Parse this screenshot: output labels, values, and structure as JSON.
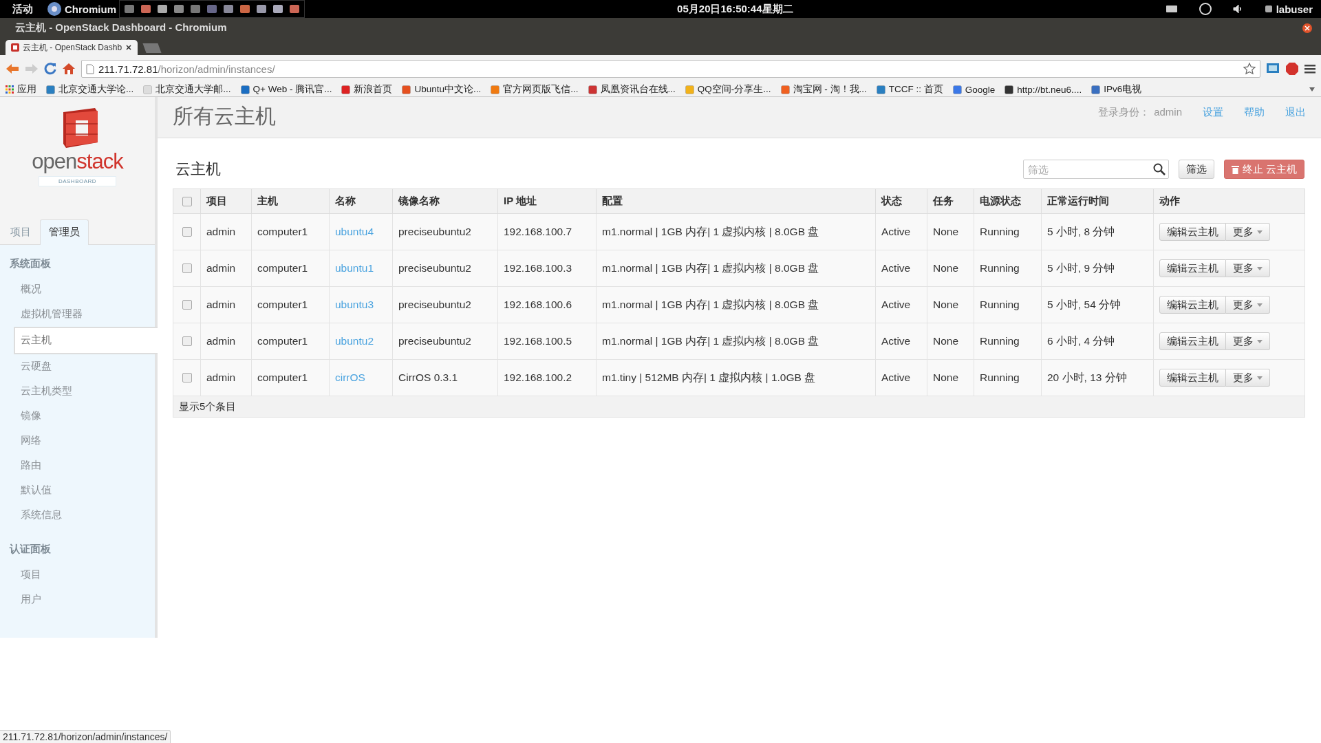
{
  "system_bar": {
    "activities": "活动",
    "app_name": "Chromium",
    "clock": "05月20日16:50:44星期二",
    "user": "labuser"
  },
  "window": {
    "title": "云主机 - OpenStack Dashboard - Chromium"
  },
  "tabs": [
    {
      "label": "云主机 - OpenStack Dashb",
      "selected": true
    }
  ],
  "address_bar": {
    "host": "211.71.72.81",
    "path": "/horizon/admin/instances/"
  },
  "bookmarks": [
    {
      "label": "应用"
    },
    {
      "label": "北京交通大学论..."
    },
    {
      "label": "北京交通大学邮..."
    },
    {
      "label": "Q+ Web - 腾讯官..."
    },
    {
      "label": "新浪首页"
    },
    {
      "label": "Ubuntu中文论..."
    },
    {
      "label": "官方网页版飞信..."
    },
    {
      "label": "凤凰资讯台在线..."
    },
    {
      "label": "QQ空间-分享生..."
    },
    {
      "label": "淘宝网 - 淘！我..."
    },
    {
      "label": "TCCF :: 首页"
    },
    {
      "label": "Google"
    },
    {
      "label": "http://bt.neu6...."
    },
    {
      "label": "IPv6电视"
    }
  ],
  "sidebar": {
    "logo": {
      "word_1": "open",
      "word_2": "stack",
      "badge": "DASHBOARD"
    },
    "tabs": [
      {
        "label": "项目",
        "selected": false
      },
      {
        "label": "管理员",
        "selected": true
      }
    ],
    "sections": [
      {
        "title": "系统面板",
        "items": [
          {
            "label": "概况",
            "selected": false
          },
          {
            "label": "虚拟机管理器",
            "selected": false
          },
          {
            "label": "云主机",
            "selected": true
          },
          {
            "label": "云硬盘",
            "selected": false
          },
          {
            "label": "云主机类型",
            "selected": false
          },
          {
            "label": "镜像",
            "selected": false
          },
          {
            "label": "网络",
            "selected": false
          },
          {
            "label": "路由",
            "selected": false
          },
          {
            "label": "默认值",
            "selected": false
          },
          {
            "label": "系统信息",
            "selected": false
          }
        ]
      },
      {
        "title": "认证面板",
        "items": [
          {
            "label": "项目",
            "selected": false
          },
          {
            "label": "用户",
            "selected": false
          }
        ]
      }
    ]
  },
  "header": {
    "title": "所有云主机",
    "user_label": "登录身份：",
    "user": "admin",
    "links": [
      "设置",
      "帮助",
      "退出"
    ]
  },
  "content": {
    "title": "云主机",
    "filter_placeholder": "筛选",
    "filter_button": "筛选",
    "terminate_button": "终止 云主机"
  },
  "table": {
    "select_all": {
      "checked": false
    },
    "columns": [
      "项目",
      "主机",
      "名称",
      "镜像名称",
      "IP 地址",
      "配置",
      "状态",
      "任务",
      "电源状态",
      "正常运行时间",
      "动作"
    ],
    "rows": [
      {
        "checked": false,
        "cells": [
          "admin",
          "computer1",
          "ubuntu4",
          "preciseubuntu2",
          "192.168.100.7",
          "m1.normal | 1GB 内存| 1 虚拟内核 | 8.0GB 盘",
          "Active",
          "None",
          "Running",
          "5 小时, 8 分钟"
        ],
        "actions": [
          "编辑云主机",
          "更多"
        ]
      },
      {
        "checked": false,
        "cells": [
          "admin",
          "computer1",
          "ubuntu1",
          "preciseubuntu2",
          "192.168.100.3",
          "m1.normal | 1GB 内存| 1 虚拟内核 | 8.0GB 盘",
          "Active",
          "None",
          "Running",
          "5 小时, 9 分钟"
        ],
        "actions": [
          "编辑云主机",
          "更多"
        ]
      },
      {
        "checked": false,
        "cells": [
          "admin",
          "computer1",
          "ubuntu3",
          "preciseubuntu2",
          "192.168.100.6",
          "m1.normal | 1GB 内存| 1 虚拟内核 | 8.0GB 盘",
          "Active",
          "None",
          "Running",
          "5 小时, 54 分钟"
        ],
        "actions": [
          "编辑云主机",
          "更多"
        ]
      },
      {
        "checked": false,
        "cells": [
          "admin",
          "computer1",
          "ubuntu2",
          "preciseubuntu2",
          "192.168.100.5",
          "m1.normal | 1GB 内存| 1 虚拟内核 | 8.0GB 盘",
          "Active",
          "None",
          "Running",
          "6 小时, 4 分钟"
        ],
        "actions": [
          "编辑云主机",
          "更多"
        ]
      },
      {
        "checked": false,
        "cells": [
          "admin",
          "computer1",
          "cirrOS",
          "CirrOS 0.3.1",
          "192.168.100.2",
          "m1.tiny | 512MB 内存| 1 虚拟内核 | 1.0GB 盘",
          "Active",
          "None",
          "Running",
          "20 小时, 13 分钟"
        ],
        "actions": [
          "编辑云主机",
          "更多"
        ]
      }
    ],
    "footer": "显示5个条目"
  },
  "status_url": "211.71.72.81/horizon/admin/instances/"
}
